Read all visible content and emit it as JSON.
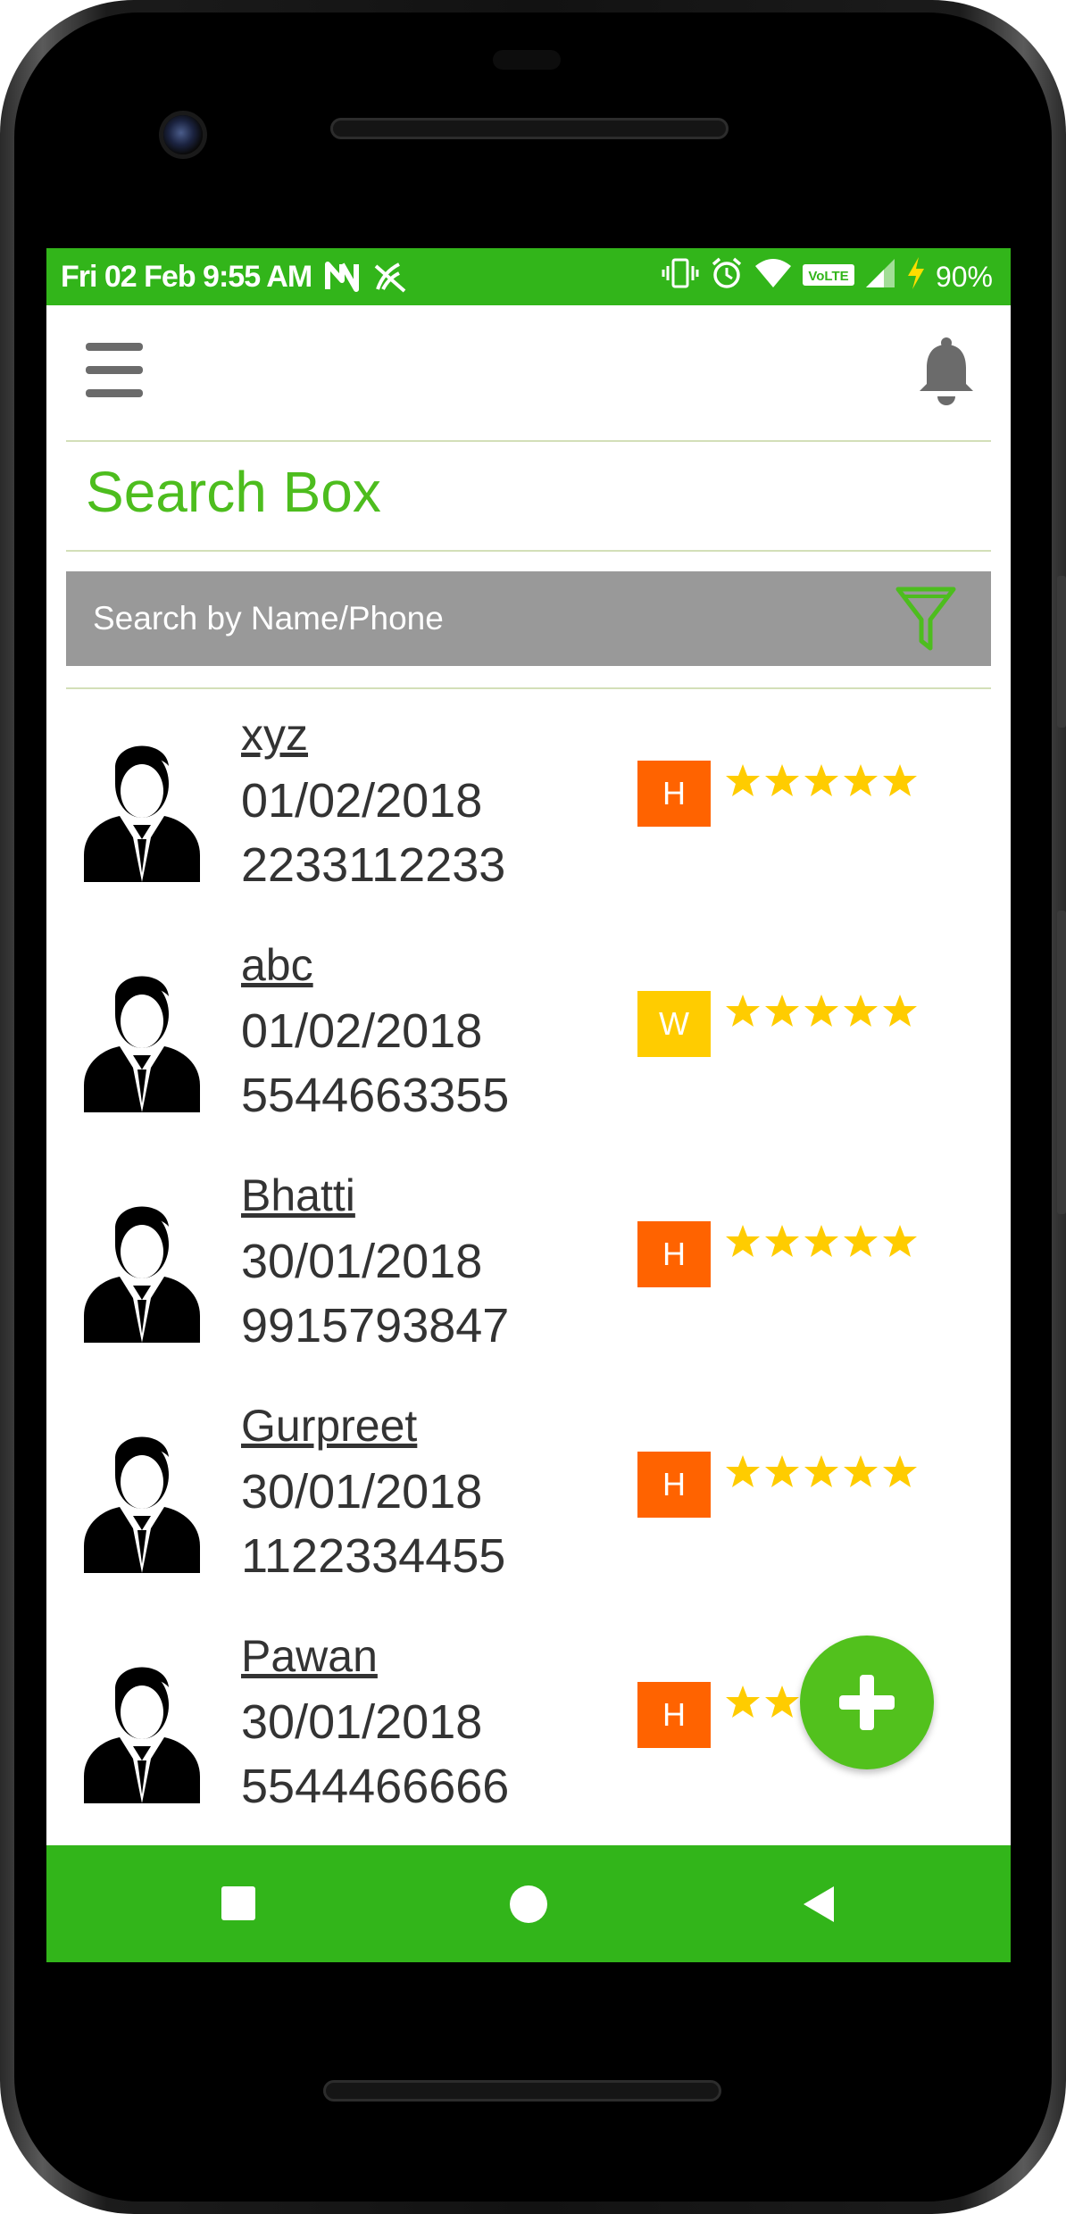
{
  "status_bar": {
    "time": "Fri 02 Feb 9:55 AM",
    "battery": "90%",
    "icons": [
      "n-notification-icon",
      "signal-off-icon",
      "vibrate-icon",
      "alarm-icon",
      "wifi-icon",
      "volte-icon",
      "cell-signal-icon",
      "charging-icon"
    ]
  },
  "header": {
    "menu_icon": "hamburger-icon",
    "notification_icon": "bell-icon"
  },
  "section": {
    "title": "Search Box"
  },
  "search": {
    "placeholder": "Search by Name/Phone",
    "filter_icon": "filter-icon"
  },
  "contacts": [
    {
      "name": "xyz",
      "date": "01/02/2018",
      "phone": "2233112233",
      "tag": "H",
      "tag_color": "#ff6300",
      "rating": 5
    },
    {
      "name": "abc",
      "date": "01/02/2018",
      "phone": "5544663355",
      "tag": "W",
      "tag_color": "#ffcc00",
      "rating": 5
    },
    {
      "name": "Bhatti",
      "date": "30/01/2018",
      "phone": "9915793847",
      "tag": "H",
      "tag_color": "#ff6300",
      "rating": 5
    },
    {
      "name": "Gurpreet",
      "date": "30/01/2018",
      "phone": "1122334455",
      "tag": "H",
      "tag_color": "#ff6300",
      "rating": 5
    },
    {
      "name": "Pawan",
      "date": "30/01/2018",
      "phone": "5544466666",
      "tag": "H",
      "tag_color": "#ff6300",
      "rating": 5
    }
  ],
  "fab": {
    "icon": "plus-icon"
  },
  "nav_bar": {
    "icons": [
      "recent-apps-icon",
      "home-icon",
      "back-icon"
    ]
  },
  "colors": {
    "primary_green": "#32b51a",
    "title_green": "#4dbd1e",
    "star_yellow": "#ffcc00",
    "search_gray": "#999999"
  }
}
